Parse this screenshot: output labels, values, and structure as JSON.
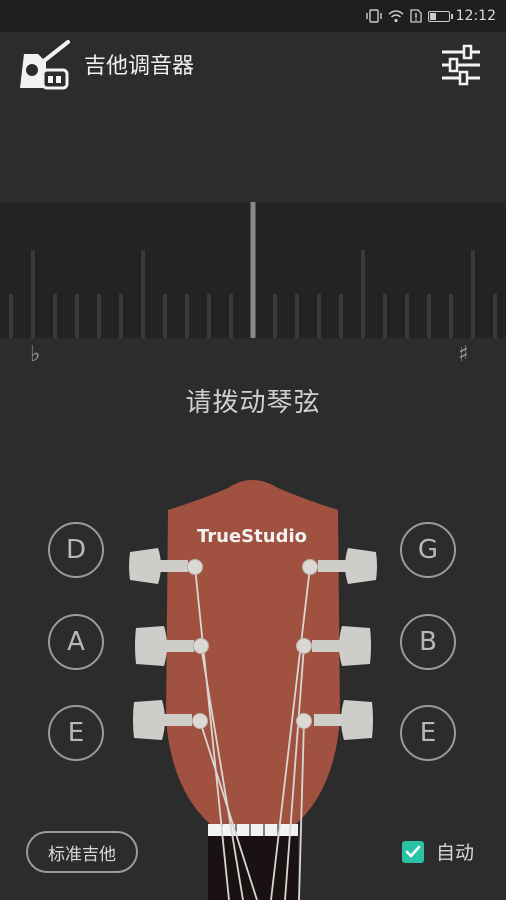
{
  "status_bar": {
    "time": "12:12",
    "battery_level": 0.35
  },
  "app_bar": {
    "title": "吉他调音器"
  },
  "meter": {
    "flat_symbol": "♭",
    "sharp_symbol": "♯",
    "needle_offset_cents": 0
  },
  "prompt": "请拨动琴弦",
  "headstock": {
    "brand": "TrueStudio",
    "body_color": "#a0513f"
  },
  "strings": {
    "left": [
      "D",
      "A",
      "E"
    ],
    "right": [
      "G",
      "B",
      "E"
    ]
  },
  "footer": {
    "preset_label": "标准吉他",
    "auto_label": "自动",
    "auto_checked": true
  },
  "colors": {
    "accent": "#2bc3a6",
    "background": "#2c2c2c",
    "meter_bg": "#232323"
  }
}
